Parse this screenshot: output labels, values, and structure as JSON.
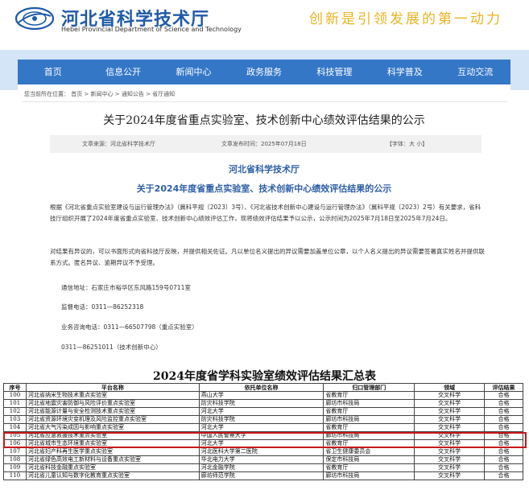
{
  "header": {
    "site_name": "河北省科学技术厅",
    "site_name_en": "Hebei Provincial Department of Science and Technology",
    "slogan": "创新是引领发展的第一动力",
    "logo_icon": "hebei-science-logo"
  },
  "nav": {
    "items": [
      "首页",
      "信息公开",
      "新闻中心",
      "政务服务",
      "科技管理",
      "科学普及",
      "互动交流"
    ]
  },
  "breadcrumb": "您当前所在位置： 首页 > 新闻中心 > 通知公告 > 省厅通知",
  "article": {
    "title": "关于2024年度省重点实验室、技术创新中心绩效评估结果的公示",
    "source": "文章来源：河北省科学技术厅",
    "date": "文章发布时间：2025年07月18日",
    "font_size": "【字体：大 小】",
    "org": "河北省科学技术厅",
    "subtitle": "关于2024年度省重点实验室、技术创新中心绩效评估结果的公示",
    "para1": "根据《河北省重点实验室建设与运行管理办法》（冀科平规〔2023〕3号）、《河北省技术创新中心建设与运行管理办法》（冀科平规〔2023〕2号）有关要求，省科技厅组织开展了2024年度省重点实验室、技术创新中心绩效评估工作，现将绩效评估结果予以公示，公示时间为2025年7月18日至2025年7月24日。",
    "para2": "对结果有异议的，可以书面形式向省科技厅反映，并提供相关佐证。凡以单位名义提出的异议需要加盖单位公章，以个人名义提出的异议需要签署真实姓名并提供联系方式。匿名异议、逾期异议不予受理。",
    "address": "通信地址：石家庄市裕华区东风路159号0711室",
    "tel": "监督电话：0311—86252318",
    "consult": "业务咨询电话：0311—66507798（重点实验室）",
    "tel2": "0311—86251011（技术创新中心）"
  },
  "table": {
    "title": "2024年度省学科实验室绩效评估结果汇总表",
    "headers": [
      "序号",
      "平台名称",
      "依托单位名称",
      "归口管理部门",
      "领域",
      "评估结果"
    ],
    "rows": [
      [
        "100",
        "河北省纳米生物技术重点实验室",
        "燕山大学",
        "省教育厅",
        "交叉科学",
        "合格"
      ],
      [
        "101",
        "河北省地震灾害防御与风险评价重点实验室",
        "防灾科技学院",
        "廊坊市科技局",
        "交叉科学",
        "合格"
      ],
      [
        "102",
        "河北省能源计量与安全检测技术重点实验室",
        "河北大学",
        "省教育厅",
        "交叉科学",
        "合格"
      ],
      [
        "103",
        "河北省资源环境灾变机理及风险监控重点实验室",
        "防灾科技学院",
        "廊坊市科技局",
        "交叉科学",
        "合格"
      ],
      [
        "104",
        "河北省大气污染成因与影响重点实验室",
        "河北大学",
        "省教育厅",
        "交叉科学",
        "合格"
      ],
      [
        "105",
        "河北省应急救援技术重点实验室",
        "中国人民警察大学",
        "廊坊市科技局",
        "交叉科学",
        "合格"
      ],
      [
        "106",
        "河北省城市生态环境重点实验室",
        "河北大学",
        "省教育厅",
        "交叉科学",
        "合格"
      ],
      [
        "107",
        "河北省妇产科再生医学重点实验室",
        "河北医科大学第二医院",
        "省卫生健康委员会",
        "交叉科学",
        "合格"
      ],
      [
        "108",
        "河北省绿色高效电工新材料与设备重点实验室",
        "华北电力大学",
        "保定市科技局",
        "交叉科学",
        "合格"
      ],
      [
        "109",
        "河北省科技金融重点实验室",
        "河北金融学院",
        "省教育厅",
        "交叉科学",
        "合格"
      ],
      [
        "110",
        "河北省儿童认知与数字化教育重点实验室",
        "廊坊师范学院",
        "廊坊市科技局",
        "交叉科学",
        "合格"
      ]
    ]
  },
  "colors": {
    "nav_bg": "#3577c7",
    "banner_bg": "#d4e5f7",
    "brand_blue": "#1f5aa8",
    "slogan": "#e9b321",
    "highlight": "#c81818"
  }
}
